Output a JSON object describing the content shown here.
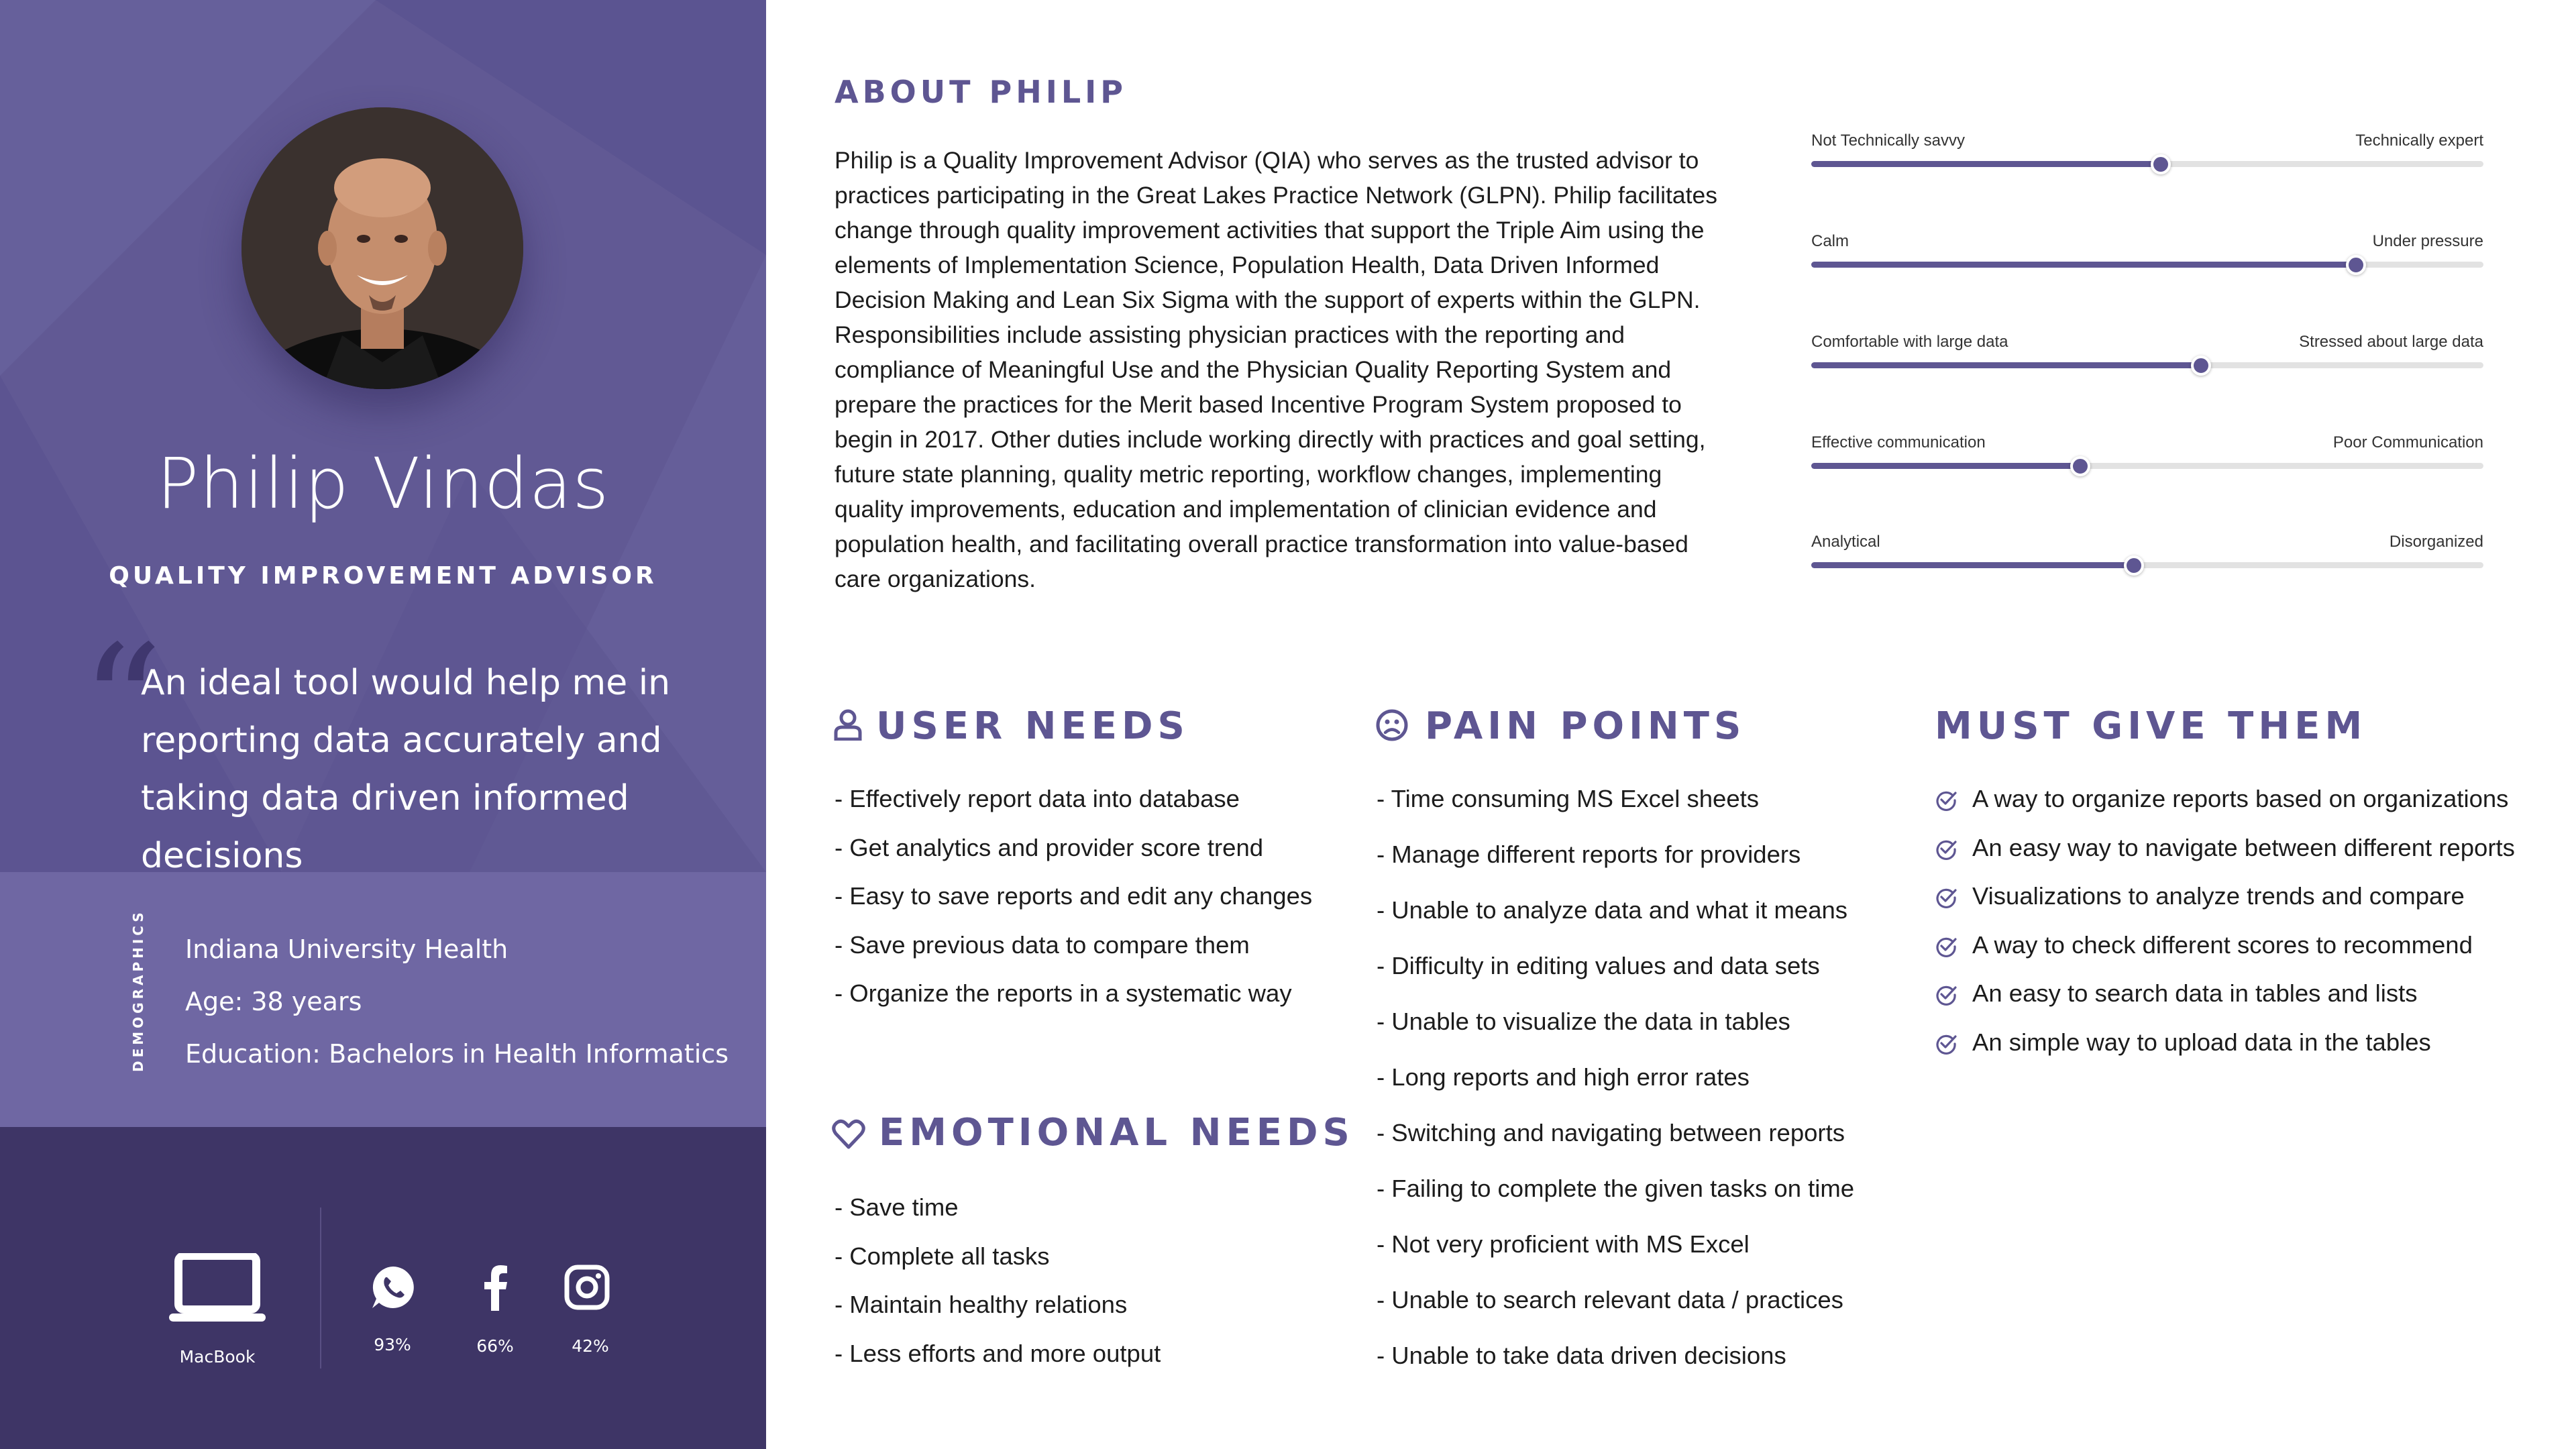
{
  "profile": {
    "name": "Philip Vindas",
    "role": "QUALITY IMPROVEMENT ADVISOR",
    "quote_mark": "“",
    "quote": "An ideal tool would help me in reporting data accurately and taking data driven informed decisions"
  },
  "demographics": {
    "label": "DEMOGRAPHICS",
    "organization": "Indiana University Health",
    "age": "Age: 38 years",
    "education": "Education: Bachelors in Health Informatics"
  },
  "devices": {
    "laptop": {
      "icon": "laptop-icon",
      "label": "MacBook"
    },
    "social": [
      {
        "icon": "whatsapp-icon",
        "value": "93%"
      },
      {
        "icon": "facebook-icon",
        "value": "66%"
      },
      {
        "icon": "instagram-icon",
        "value": "42%"
      }
    ]
  },
  "about": {
    "title": "ABOUT PHILIP",
    "text": "Philip is a Quality Improvement Advisor (QIA) who serves as the trusted advisor to practices participating in the Great Lakes Practice Network (GLPN). Philip facilitates change through quality improvement activities that support the Triple Aim using the elements of Implementation Science, Population Health, Data Driven Informed Decision Making and Lean Six Sigma with the support of experts within the GLPN. Responsibilities include assisting physician practices with the reporting and compliance of Meaningful Use and the Physician Quality Reporting System and prepare the practices for the Merit based Incentive Program System proposed to begin in 2017. Other duties include working directly with practices and goal setting, future state planning, quality metric reporting, workflow changes, implementing quality improvements, education and implementation of clinician evidence and population health, and facilitating overall practice transformation into value-based care organizations."
  },
  "traits": [
    {
      "left": "Not Technically savvy",
      "right": "Technically expert",
      "value": 0.52
    },
    {
      "left": "Calm",
      "right": "Under pressure",
      "value": 0.81
    },
    {
      "left": "Comfortable with large data",
      "right": "Stressed about large data",
      "value": 0.58
    },
    {
      "left": "Effective communication",
      "right": "Poor Communication",
      "value": 0.4
    },
    {
      "left": "Analytical",
      "right": "Disorganized",
      "value": 0.48
    }
  ],
  "user_needs": {
    "title": "USER NEEDS",
    "icon": "user-icon",
    "items": [
      " - Effectively report data into database",
      " - Get analytics and provider score trend",
      " - Easy to save reports and edit any changes",
      " - Save previous data to compare them",
      " - Organize the reports in a systematic way"
    ]
  },
  "emotional_needs": {
    "title": "EMOTIONAL NEEDS",
    "icon": "heart-icon",
    "items": [
      "- Save time",
      "- Complete all tasks",
      "- Maintain healthy relations",
      "- Less efforts and more output"
    ]
  },
  "pain_points": {
    "title": "PAIN POINTS",
    "icon": "sad-face-icon",
    "items": [
      "- Time consuming MS Excel sheets",
      "- Manage different reports for providers",
      "- Unable to analyze data and what it means",
      "- Difficulty in editing values and data sets",
      "- Unable to visualize the data in tables",
      "- Long reports and high error rates",
      "- Switching and navigating between reports",
      "- Failing to complete the given tasks on time",
      "- Not very proficient with MS Excel",
      "- Unable to search relevant data / practices",
      "- Unable to take data driven decisions"
    ]
  },
  "must_give": {
    "title": "MUST GIVE THEM",
    "icon": "check-circle-icon",
    "items": [
      "A way to organize reports based on organizations",
      "An easy way to navigate between different reports",
      "Visualizations to analyze trends and compare",
      "A way to check different scores to recommend",
      "An easy to search data in tables and lists",
      "An simple way to upload data in the tables"
    ]
  },
  "colors": {
    "accent": "#5e5692",
    "panel": "#615994",
    "demo_band": "#6f67a3",
    "device_band": "#3e3566"
  }
}
